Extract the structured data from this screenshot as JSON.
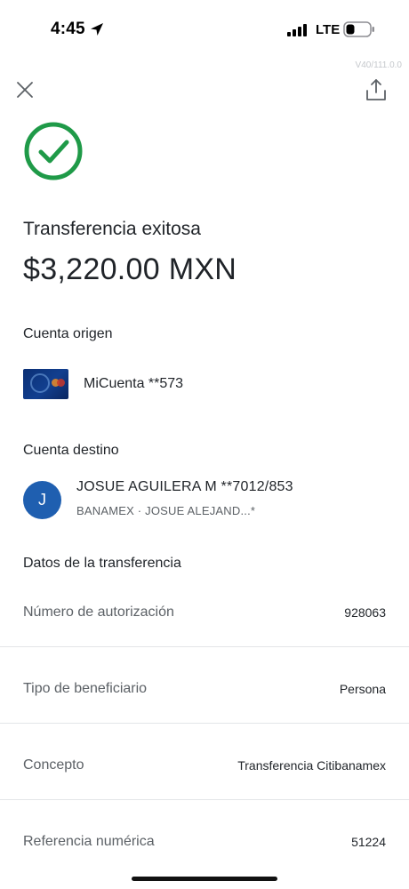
{
  "status_bar": {
    "time": "4:45",
    "network": "LTE"
  },
  "app": {
    "version": "V40/111.0.0"
  },
  "receipt": {
    "title": "Transferencia exitosa",
    "amount": "$3,220.00 MXN"
  },
  "origin": {
    "heading": "Cuenta origen",
    "account": "MiCuenta  **573"
  },
  "destination": {
    "heading": "Cuenta destino",
    "avatar_initial": "J",
    "name": "JOSUE AGUILERA M  **7012/853",
    "subtitle": "BANAMEX · JOSUE ALEJAND...*"
  },
  "details": {
    "heading": "Datos de la transferencia",
    "rows": [
      {
        "label": "Número de autorización",
        "value": "928063"
      },
      {
        "label": "Tipo de beneficiario",
        "value": "Persona"
      },
      {
        "label": "Concepto",
        "value": "Transferencia Citibanamex"
      },
      {
        "label": "Referencia numérica",
        "value": "51224"
      }
    ]
  },
  "icons": {
    "close": "close-icon",
    "share": "share-icon",
    "success": "check-circle-icon",
    "location": "location-arrow-icon",
    "signal": "signal-icon",
    "battery": "battery-icon"
  },
  "colors": {
    "success_green": "#1f9a48",
    "avatar_blue": "#1f5fb0",
    "text_primary": "#1f2328",
    "text_secondary": "#5c6166"
  }
}
